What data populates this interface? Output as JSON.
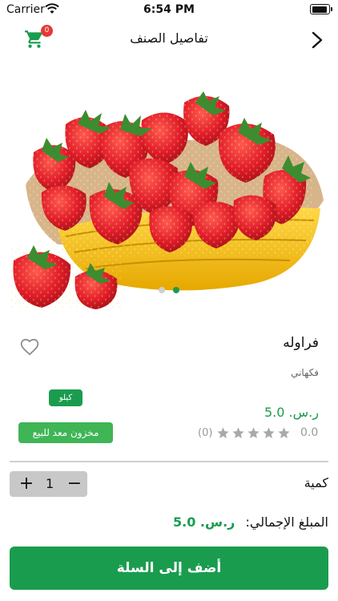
{
  "status_bar": {
    "carrier": "Carrier",
    "time": "6:54 PM"
  },
  "nav": {
    "title": "تفاصيل الصنف",
    "cart_count": "0"
  },
  "product": {
    "name": "فراوله",
    "category": "فكهاني",
    "unit": "كيلو",
    "stock_status": "مخزون معد للبيع",
    "price": "ر.س. 5.0",
    "rating_value": "0.0",
    "rating_count": "(0)",
    "rating_stars": 0,
    "image_count": 2,
    "active_image_index": 2
  },
  "quantity": {
    "label": "كمية",
    "value": "1",
    "plus": "+",
    "minus": "−"
  },
  "total": {
    "label": "المبلغ الإجمالي:",
    "value": "ر.س. 5.0"
  },
  "actions": {
    "add_to_cart": "أضف إلى السلة"
  },
  "colors": {
    "accent": "#1a9c4e",
    "badge": "#e53935",
    "stock": "#3fb556"
  }
}
